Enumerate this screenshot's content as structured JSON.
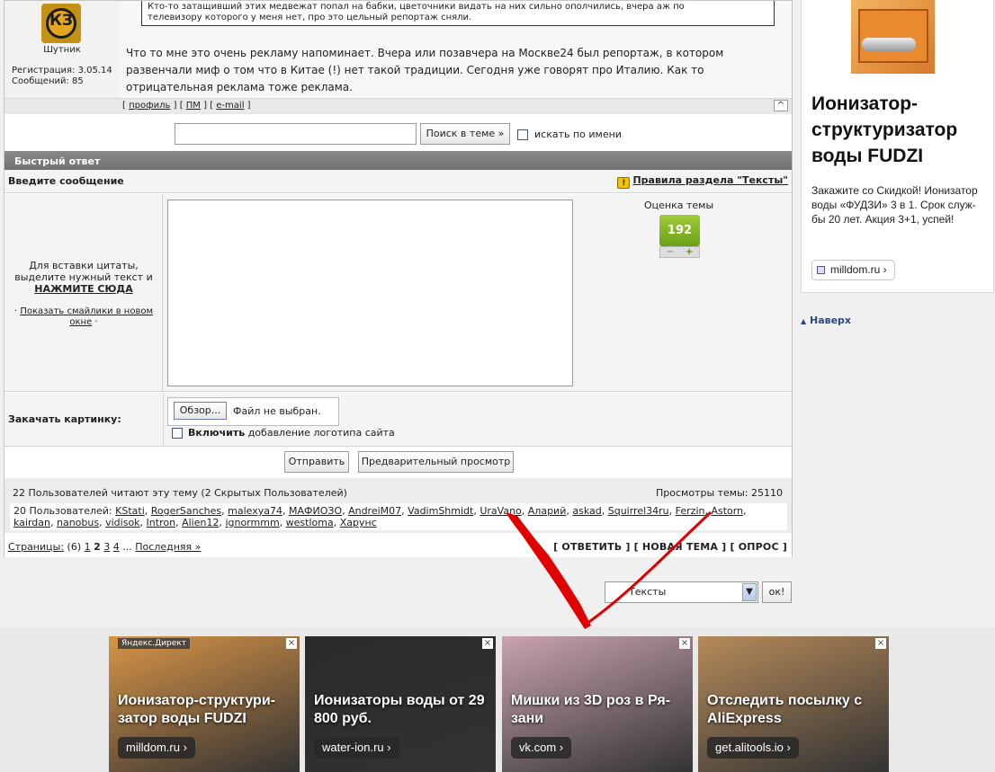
{
  "post": {
    "quote_line1": "Кто-то затащивший этих медвежат попал на бабки, цветочники видать на них сильно ополчились, вчера аж по",
    "quote_line2": "телевизору которого у меня нет, про это цельный репортаж сняли.",
    "author_avatar": "КЗ",
    "author_name": "Шутник",
    "registration": "Регистрация: 3.05.14",
    "messages": "Сообщений: 85",
    "text": "Что то мне это очень рекламу напоминает. Вчера или позавчера на Москве24 был репортаж, в котором развенчали миф о том что в Китае (!) нет такой традиции. Сегодня уже говорят про Италию. Как то отрицательная реклама тоже реклама.",
    "link_profile": "профиль",
    "link_pm": "ПМ",
    "link_email": "e-mail",
    "up_btn": "^"
  },
  "search": {
    "button": "Поиск в теме »",
    "by_name": "искать по имени"
  },
  "quick_reply": {
    "header": "Быстрый ответ",
    "enter_message": "Введите сообщение",
    "warn_icon": "!",
    "rules_link": "Правила раздела \"Тексты\"",
    "quote_hint": "Для вставки цитаты, выделите нужный текст и",
    "quote_click": "НАЖМИТЕ СЮДА",
    "smiles_link": "Показать смайлики в новом окне",
    "rating_label": "Оценка темы",
    "rating_value": "192",
    "rating_minus": "−",
    "rating_plus": "+",
    "upload_label": "Закачать картинку:",
    "browse_btn": "Обзор...",
    "no_file": "Файл не выбран.",
    "logo_bold": "Включить",
    "logo_rest": "добавление логотипа сайта",
    "send_btn": "Отправить",
    "preview_btn": "Предварительный просмотр"
  },
  "readers": {
    "header": "22 Пользователей читают эту тему (2 Скрытых Пользователей)",
    "views": "Просмотры темы: 25110",
    "list_prefix": "20 Пользователей:",
    "users": [
      "KStati",
      "RogerSanches",
      "malexya74",
      "МАФИОЗО",
      "AndreiM07",
      "VadimShmidt",
      "UraVano",
      "Аларий",
      "askad",
      "Squirrel34ru",
      "Ferzin",
      "Astorn",
      "kairdan",
      "nanobus",
      "vidisok",
      "Intron",
      "Alien12",
      "ignormmm",
      "westloma",
      "Харунс"
    ]
  },
  "pagination": {
    "label": "Страницы:",
    "count": "(6)",
    "pages": [
      "1",
      "2",
      "3",
      "4"
    ],
    "current": "2",
    "ellipsis": "...",
    "last": "Последняя »",
    "reply": "[ ОТВЕТИТЬ ]",
    "new_topic": "[ НОВАЯ ТЕМА ]",
    "poll": "[ ОПРОС ]"
  },
  "forum_jump": {
    "selected": "Тексты",
    "go_btn": "ок!"
  },
  "side_ad": {
    "title": "Ионизатор-структуризатор воды FUDZI",
    "desc": "Закажите со Скидкой! Ионизатор воды «ФУДЗИ» 3 в 1. Срок служ-бы 20 лет. Акция 3+1, успей!",
    "link": "milldom.ru ›",
    "top_link": "Наверх"
  },
  "bottom_ads": {
    "label": "Яндекс.Директ",
    "close": "×",
    "cards": [
      {
        "title": "Ионизатор-структури-затор воды FUDZI",
        "link": "milldom.ru ›",
        "bg": "#d79447"
      },
      {
        "title": "Ионизаторы воды от 29 800 руб.",
        "link": "water-ion.ru ›",
        "bg": "#2a2a2a"
      },
      {
        "title": "Мишки из 3D роз в Ря-зани",
        "link": "vk.com ›",
        "bg": "#c9a3ad"
      },
      {
        "title": "Отследить посылку с AliExpress",
        "link": "get.alitools.io ›",
        "bg": "#b58a5a"
      }
    ]
  },
  "colors": {
    "rating_green": "#7fb321",
    "header_gray": "#7a7a7a",
    "annotation_red": "#e00000"
  }
}
